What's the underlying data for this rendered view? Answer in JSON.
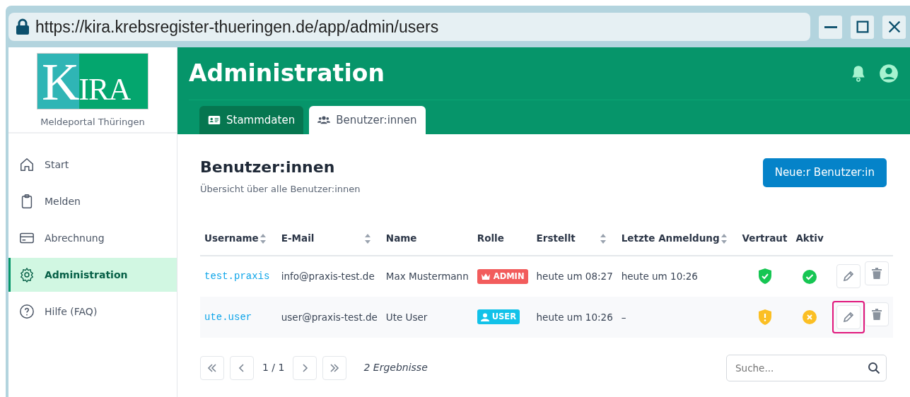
{
  "browser": {
    "url": "https://kira.krebsregister-thueringen.de/app/admin/users"
  },
  "sidebar": {
    "logo": "KIRA",
    "subtitle": "Meldeportal Thüringen",
    "items": [
      {
        "label": "Start",
        "selected": false
      },
      {
        "label": "Melden",
        "selected": false
      },
      {
        "label": "Abrechnung",
        "selected": false
      },
      {
        "label": "Administration",
        "selected": true
      },
      {
        "label": "Hilfe (FAQ)",
        "selected": false
      }
    ]
  },
  "header": {
    "title": "Administration",
    "tabs": [
      {
        "label": "Stammdaten",
        "selected": false
      },
      {
        "label": "Benutzer:innen",
        "selected": true
      }
    ]
  },
  "page": {
    "title": "Benutzer:innen",
    "subtitle": "Übersicht über alle Benutzer:innen",
    "new_button": "Neue:r Benutzer:in"
  },
  "table": {
    "columns": [
      {
        "label": "Username",
        "sortable": true
      },
      {
        "label": "E-Mail",
        "sortable": true
      },
      {
        "label": "Name",
        "sortable": false
      },
      {
        "label": "Rolle",
        "sortable": false
      },
      {
        "label": "Erstellt",
        "sortable": true
      },
      {
        "label": "Letzte Anmeldung",
        "sortable": true
      },
      {
        "label": "Vertraut",
        "sortable": false
      },
      {
        "label": "Aktiv",
        "sortable": false
      }
    ],
    "rows": [
      {
        "username": "test.praxis",
        "email": "info@praxis-test.de",
        "name": "Max Mustermann",
        "role": {
          "kind": "admin",
          "label": "ADMIN"
        },
        "created": "heute um 08:27",
        "last_login": "heute um 10:26",
        "trusted": true,
        "active": true,
        "edit_highlighted": false
      },
      {
        "username": "ute.user",
        "email": "user@praxis-test.de",
        "name": "Ute User",
        "role": {
          "kind": "user",
          "label": "USER"
        },
        "created": "heute um 10:26",
        "last_login": "–",
        "trusted": false,
        "active": false,
        "edit_highlighted": true
      }
    ]
  },
  "pagination": {
    "page": "1 / 1",
    "results": "2 Ergebnisse"
  },
  "search": {
    "placeholder": "Suche..."
  }
}
